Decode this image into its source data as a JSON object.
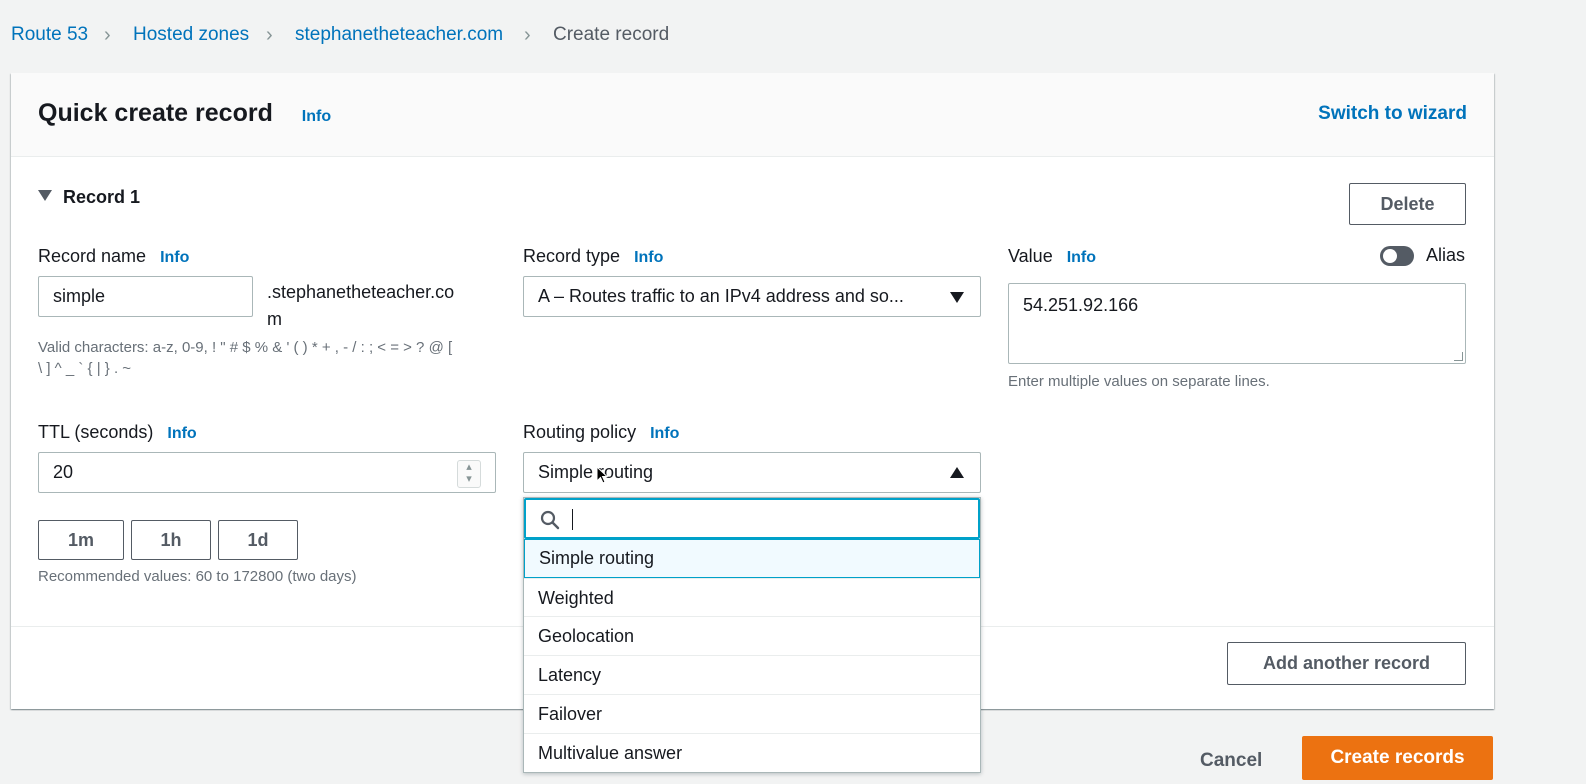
{
  "breadcrumb": {
    "items": [
      "Route 53",
      "Hosted zones",
      "stephanetheteacher.com"
    ],
    "current": "Create record"
  },
  "panel": {
    "title": "Quick create record",
    "info": "Info",
    "switch_wizard": "Switch to wizard"
  },
  "record": {
    "header": "Record 1",
    "delete_label": "Delete",
    "name": {
      "label": "Record name",
      "info": "Info",
      "value": "simple",
      "suffix_line1": ".stephanetheteacher.co",
      "suffix_line2": "m",
      "hint_line1": "Valid characters: a-z, 0-9, ! \" # $ % & ' ( ) * + , - / : ; < = > ? @ [",
      "hint_line2": "\\ ] ^ _ ` { | } . ~"
    },
    "type": {
      "label": "Record type",
      "info": "Info",
      "value": "A – Routes traffic to an IPv4 address and so..."
    },
    "value": {
      "label": "Value",
      "info": "Info",
      "alias_label": "Alias",
      "text": "54.251.92.166",
      "hint": "Enter multiple values on separate lines."
    },
    "ttl": {
      "label": "TTL (seconds)",
      "info": "Info",
      "value": "20",
      "presets": [
        "1m",
        "1h",
        "1d"
      ],
      "hint": "Recommended values: 60 to 172800 (two days)"
    },
    "routing": {
      "label": "Routing policy",
      "info": "Info",
      "value": "Simple routing",
      "search_placeholder": "",
      "options": [
        "Simple routing",
        "Weighted",
        "Geolocation",
        "Latency",
        "Failover",
        "Multivalue answer"
      ]
    }
  },
  "add_record_label": "Add another record",
  "footer": {
    "cancel": "Cancel",
    "create": "Create records"
  },
  "colors": {
    "link": "#0073bb",
    "primary": "#ec7211",
    "focus": "#00a1c9"
  }
}
